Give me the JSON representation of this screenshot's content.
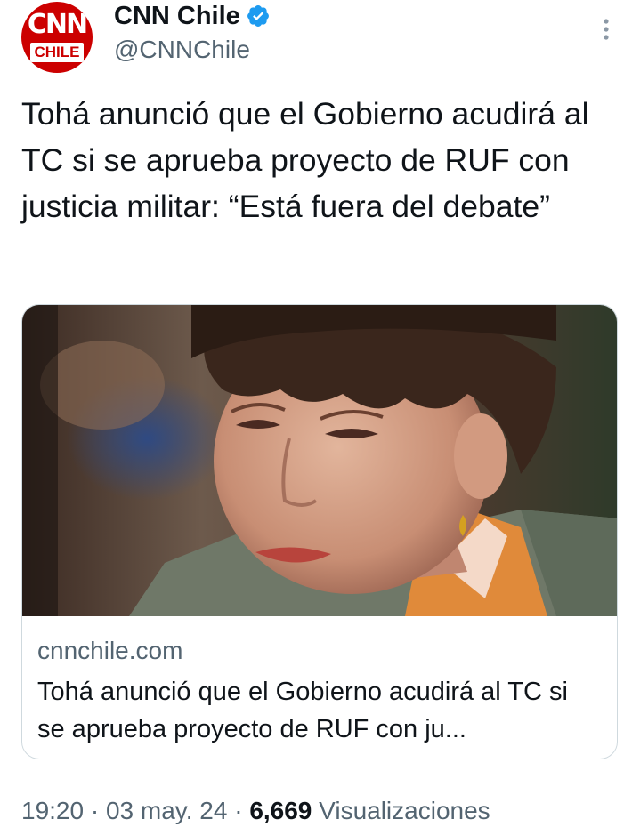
{
  "account": {
    "logo_text": "CNN",
    "logo_subtext": "CHILE",
    "display_name": "CNN Chile",
    "handle": "@CNNChile",
    "verified": true
  },
  "tweet": {
    "text": "Tohá anunció que el Gobierno acudirá al TC si se aprueba proyecto de RUF con justicia militar: “Está fuera del debate”"
  },
  "card": {
    "domain": "cnnchile.com",
    "title": "Tohá anunció que el Gobierno acudirá al TC si se aprueba proyecto de RUF con ju..."
  },
  "meta": {
    "time": "19:20",
    "separator": " · ",
    "date": "03 may. 24",
    "views_count": "6,669",
    "views_label": "Visualizaciones"
  },
  "colors": {
    "brand": "#cc0000",
    "verified": "#1d9bf0",
    "text_primary": "#0f1419",
    "text_secondary": "#536471",
    "border": "#cfd9de"
  },
  "icons": {
    "verified": "verified-badge-icon",
    "more": "more-options-icon"
  }
}
